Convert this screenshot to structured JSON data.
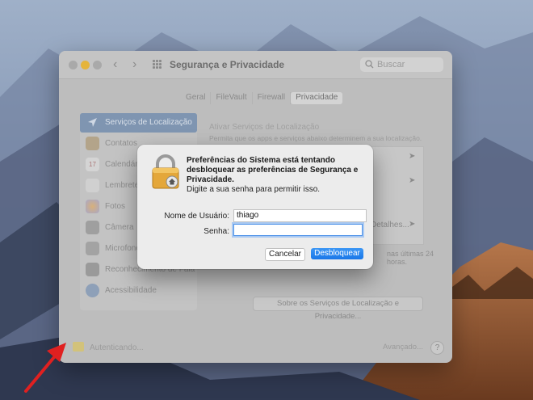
{
  "window": {
    "title": "Segurança e Privacidade",
    "search_placeholder": "Buscar",
    "tabs": [
      {
        "label": "Geral",
        "active": false
      },
      {
        "label": "FileVault",
        "active": false
      },
      {
        "label": "Firewall",
        "active": false
      },
      {
        "label": "Privacidade",
        "active": true
      }
    ],
    "sidebar": {
      "items": [
        {
          "label": "Serviços de Localização",
          "icon": "location-arrow-icon",
          "selected": true
        },
        {
          "label": "Contatos",
          "icon": "contacts-icon",
          "selected": false
        },
        {
          "label": "Calendário",
          "icon": "calendar-icon",
          "selected": false
        },
        {
          "label": "Lembretes",
          "icon": "reminders-icon",
          "selected": false
        },
        {
          "label": "Fotos",
          "icon": "photos-icon",
          "selected": false
        },
        {
          "label": "Câmera",
          "icon": "camera-icon",
          "selected": false
        },
        {
          "label": "Microfone",
          "icon": "microphone-icon",
          "selected": false
        },
        {
          "label": "Reconhecimento de Fala",
          "icon": "speech-recognition-icon",
          "selected": false
        },
        {
          "label": "Acessibilidade",
          "icon": "accessibility-icon",
          "selected": false
        }
      ]
    },
    "main": {
      "location_checkbox_label": "Ativar Serviços de Localização",
      "location_description": "Permita que os apps e serviços abaixo determinem a sua localização.",
      "details_button": "Detalhes...",
      "hours_text": "nas últimas 24 horas.",
      "about_button": "Sobre os Serviços de Localização e Privacidade..."
    },
    "footer": {
      "lock_text": "Autenticando...",
      "advanced_button": "Avançado...",
      "help_button": "?"
    }
  },
  "dialog": {
    "title": "Preferências do Sistema está tentando desbloquear as preferências de Segurança e Privacidade.",
    "message": "Digite a sua senha para permitir isso.",
    "username_label": "Nome de Usuário:",
    "username_value": "thiago",
    "password_label": "Senha:",
    "password_value": "",
    "cancel_button": "Cancelar",
    "unlock_button": "Desbloquear"
  },
  "colors": {
    "accent": "#1977e8",
    "annotation_arrow": "#e02020"
  }
}
